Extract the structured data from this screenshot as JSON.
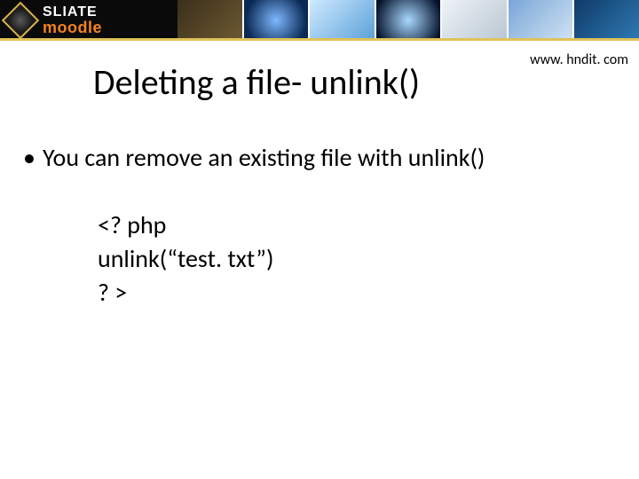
{
  "header": {
    "logo_top": "SLIATE",
    "logo_bottom": "moodle"
  },
  "url": "www. hndit. com",
  "title": "Deleting a file- unlink()",
  "bullet": "You can remove an existing file with unlink()",
  "code": {
    "l1": "<? php",
    "l2": "unlink(“test. txt”)",
    "l3": "? >"
  }
}
